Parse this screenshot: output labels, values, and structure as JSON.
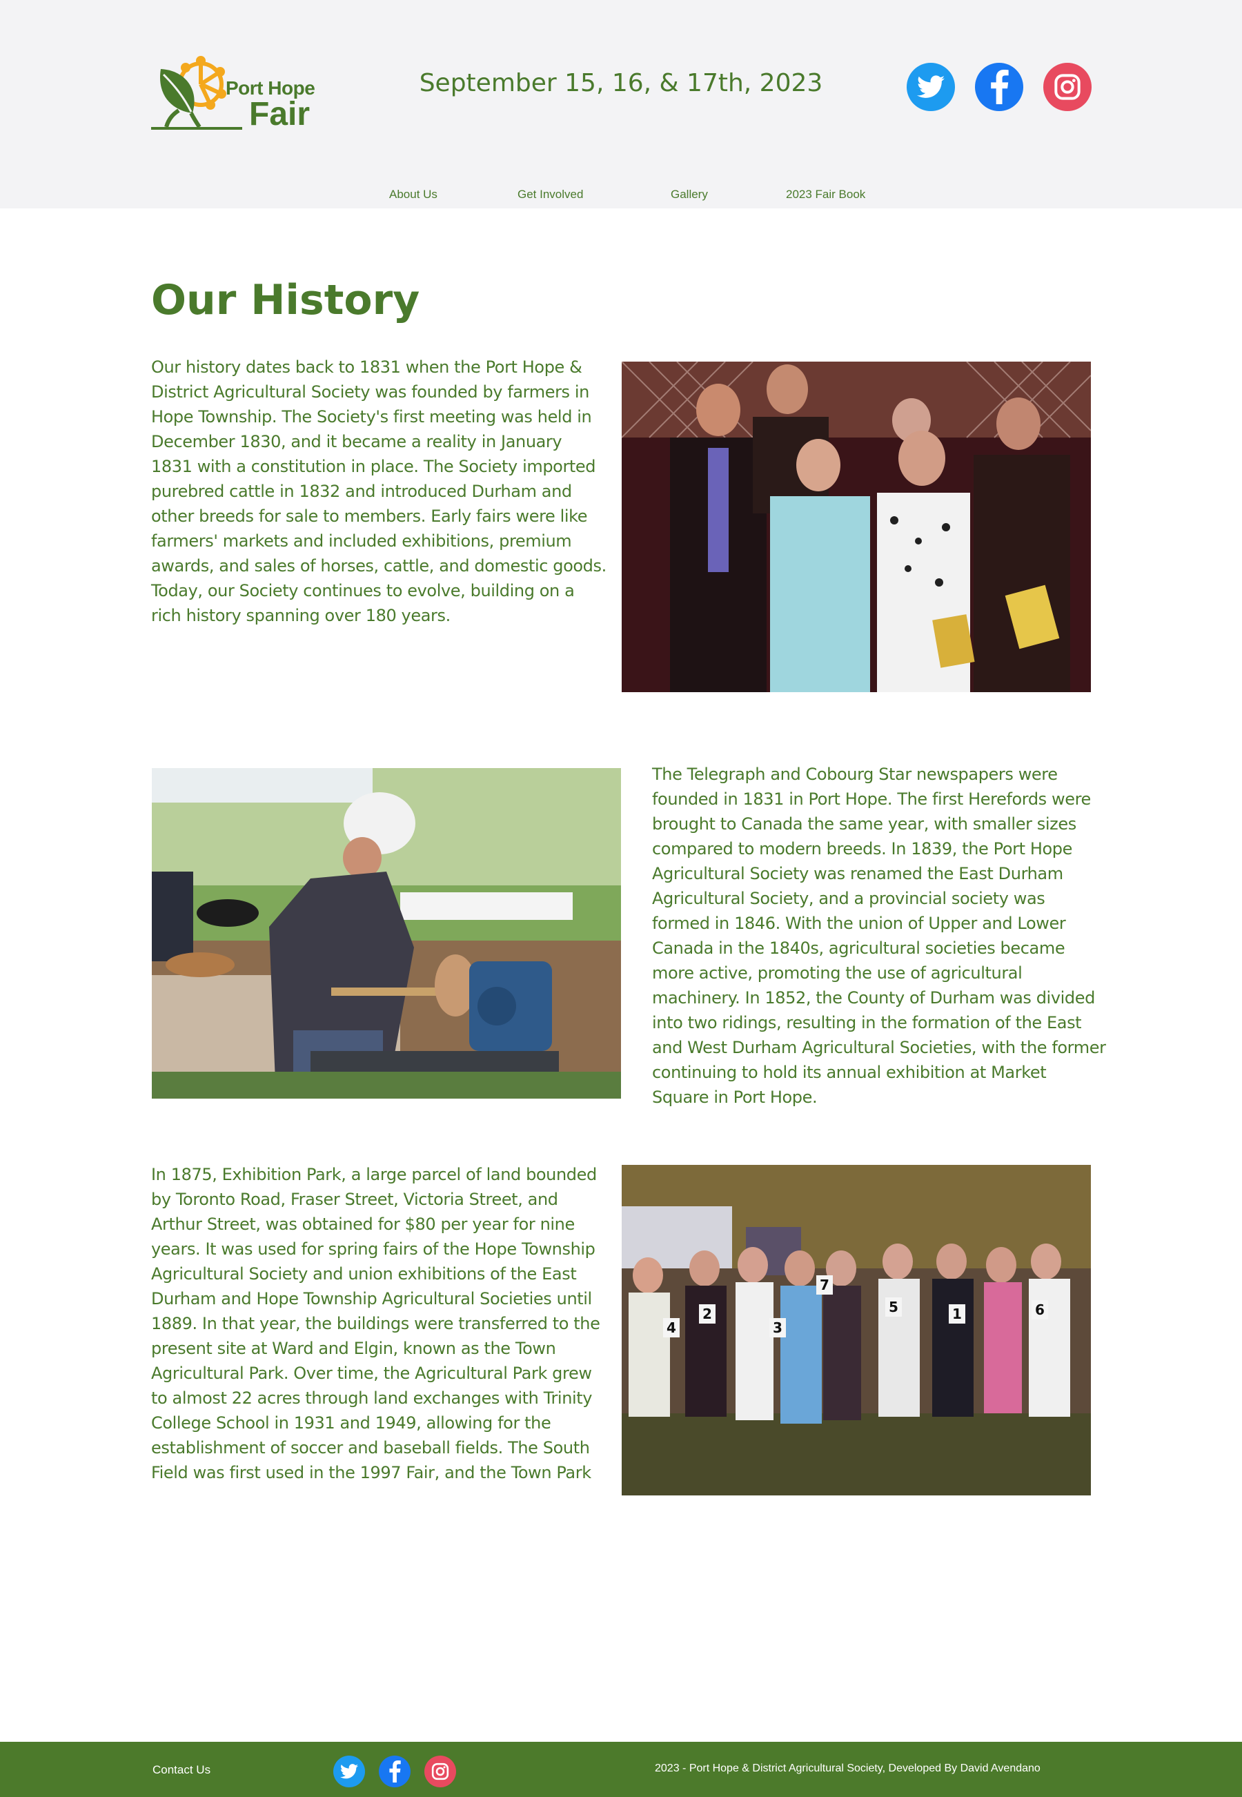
{
  "brand": {
    "logo_top": "Port Hope",
    "logo_bottom": "Fair",
    "colors": {
      "green": "#4a7a2c",
      "orange": "#f4a81d",
      "footer_green": "#4c7a2b",
      "header_bg": "#f3f3f5"
    }
  },
  "header": {
    "date": "September 15, 16, & 17th, 2023",
    "social": [
      "twitter-icon",
      "facebook-icon",
      "instagram-icon"
    ]
  },
  "nav": {
    "items": [
      {
        "label": "About Us"
      },
      {
        "label": "Get Involved"
      },
      {
        "label": "Gallery"
      },
      {
        "label": "2023 Fair Book"
      }
    ]
  },
  "main": {
    "title": "Our History",
    "paragraphs": [
      "Our history dates back to 1831 when the Port Hope & District Agricultural Society was founded by farmers in Hope Township. The Society's first meeting was held in December 1830, and it became a reality in January 1831 with a constitution in place. The Society imported purebred cattle in 1832 and introduced Durham and other breeds for sale to members. Early fairs were like farmers' markets and included exhibitions, premium awards, and sales of horses, cattle, and domestic goods. Today, our Society continues to evolve, building on a rich history spanning over 180 years.",
      "The Telegraph and Cobourg Star newspapers were founded in 1831 in Port Hope. The first Herefords were brought to Canada the same year, with smaller sizes compared to modern breeds. In 1839, the Port Hope Agricultural Society was renamed the East Durham Agricultural Society, and a provincial society was formed in 1846. With the union of Upper and Lower Canada in the 1840s, agricultural societies became more active, promoting the use of agricultural machinery. In 1852, the County of Durham was divided into two ridings, resulting in the formation of the East and West Durham Agricultural Societies, with the former continuing to hold its annual exhibition at Market Square in Port Hope.",
      "In 1875, Exhibition Park, a large parcel of land bounded by Toronto Road, Fraser Street, Victoria Street, and Arthur Street, was obtained for $80 per year for nine years. It was used for spring fairs of the Hope Township Agricultural Society and union exhibitions of the East Durham and Hope Township Agricultural Societies until 1889. In that year, the buildings were transferred to the present site at Ward and Elgin, known as the Town Agricultural Park. Over time, the Agricultural Park grew to almost 22 acres through land exchanges with Trinity College School in 1931 and 1949, allowing for the establishment of soccer and baseball fields. The South Field was first used in the 1997 Fair, and the Town Park"
    ],
    "photos": [
      {
        "name": "society-members-photo"
      },
      {
        "name": "woodturning-demo-photo"
      },
      {
        "name": "competitors-group-photo",
        "numbers": [
          "4",
          "2",
          "3",
          "7",
          "5",
          "1",
          "6"
        ]
      }
    ]
  },
  "footer": {
    "contact": "Contact Us",
    "credit": "2023 - Port Hope & District Agricultural Society, Developed By David Avendano",
    "social": [
      "twitter-icon",
      "facebook-icon",
      "instagram-icon"
    ]
  }
}
